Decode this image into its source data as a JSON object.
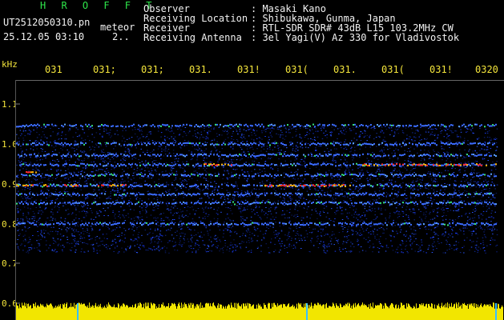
{
  "header": {
    "brand": "H R O F F T",
    "filename": "UT2512050310.pn",
    "meteor_label": "meteor",
    "timestamp": "25.12.05 03:10",
    "counter": "2.."
  },
  "info": {
    "rows": [
      {
        "label": "Observer",
        "value": ": Masaki Kano"
      },
      {
        "label": "Receiving Location",
        "value": ": Shibukawa, Gunma, Japan"
      },
      {
        "label": "Receiver",
        "value": ": RTL-SDR SDR# 43dB L15 103.2MHz CW"
      },
      {
        "label": "Receiving Antenna",
        "value": ": 3el Yagi(V) Az 330 for Vladivostok"
      }
    ]
  },
  "axes": {
    "y_unit": "kHz",
    "y_ticks": [
      "1.1",
      "1.0",
      "0.9",
      "0.8",
      "0.7",
      "0.6"
    ],
    "x_ticks": [
      "031",
      "031;",
      "031;",
      "031.",
      "031!",
      "031(",
      "031.",
      "031(",
      "031!",
      "0320"
    ]
  },
  "colors": {
    "background": "#000000",
    "brand": "#2ee64a",
    "label": "#f3e43b",
    "text": "#f2f2f2",
    "signal_base": "#1a3cff",
    "signal_hot": "#ff2a2a",
    "activity_bar": "#f2e600"
  }
}
